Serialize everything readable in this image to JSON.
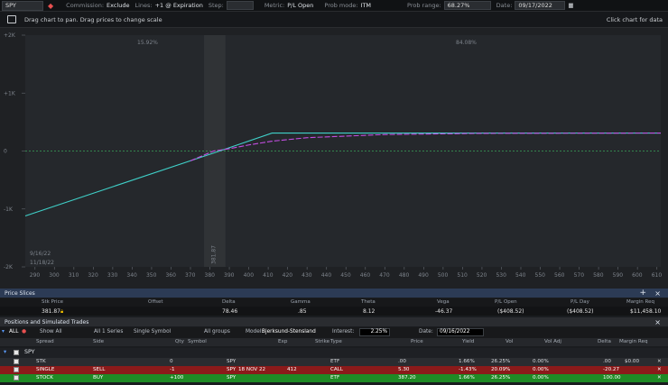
{
  "toolbar": {
    "symbol": "SPY",
    "commission_label": "Commission:",
    "commission_value": "Exclude",
    "lines_label": "Lines:",
    "lines_value": "+1 @ Expiration",
    "step_label": "Step:",
    "step_value": "",
    "metric_label": "Metric:",
    "metric_value": "P/L Open",
    "probmode_label": "Prob mode:",
    "probmode_value": "ITM",
    "probrange_label": "Prob range:",
    "probrange_value": "68.27%",
    "date_label": "Date:",
    "date_value": "09/17/2022"
  },
  "subbar": {
    "hint": "Drag chart to pan. Drag prices to change scale",
    "right": "Click chart for data"
  },
  "chart_data": {
    "type": "line",
    "y_ticks": [
      "+2K",
      "+1K",
      "0",
      "-1K",
      "-2K"
    ],
    "y_tick_values": [
      2000,
      1000,
      0,
      -1000,
      -2000
    ],
    "ylim": [
      -2000,
      2000
    ],
    "x_ticks": [
      "290",
      "300",
      "310",
      "320",
      "330",
      "340",
      "350",
      "360",
      "370",
      "380",
      "390",
      "400",
      "410",
      "420",
      "430",
      "440",
      "450",
      "460",
      "470",
      "480",
      "490",
      "500",
      "510",
      "520",
      "530",
      "540",
      "550",
      "560",
      "570",
      "580",
      "590",
      "600",
      "610"
    ],
    "xlim": [
      285,
      612
    ],
    "prob_left": "15.92%",
    "prob_right": "84.08%",
    "price_marker": "381.87",
    "date1": "9/16/22",
    "date2": "11/18/22",
    "series": [
      {
        "x": [
          285,
          385,
          412,
          612
        ],
        "y": [
          -1120,
          0,
          310,
          310
        ],
        "color": "#3fd0c8"
      },
      {
        "x": [
          370,
          381.87,
          390,
          400,
          412,
          430,
          470,
          520,
          612
        ],
        "y": [
          -170,
          0,
          40,
          105,
          170,
          230,
          285,
          305,
          310
        ],
        "color": "#c24ee0"
      }
    ]
  },
  "price_slices": {
    "title": "Price Slices",
    "headers": [
      "Stk Price",
      "Offset",
      "Delta",
      "Gamma",
      "Theta",
      "Vega",
      "P/L Open",
      "P/L Day",
      "Margin Req"
    ],
    "values": [
      "381.87",
      "",
      "78.46",
      ".85",
      "8.12",
      "-46.37",
      "($408.52)",
      "($408.52)",
      "$11,458.10"
    ]
  },
  "positions": {
    "title": "Positions and Simulated Trades",
    "filters": {
      "all": "ALL",
      "show": "Show All",
      "series": "All 1 Series",
      "single": "Single Symbol",
      "groups": "All groups",
      "model_label": "Model:",
      "model_value": "Bjerksund-Stensland",
      "interest_label": "Interest:",
      "interest_value": "2.25%",
      "date_label": "Date:",
      "date_value": "09/16/2022"
    },
    "headers": [
      "Spread",
      "Side",
      "Qty",
      "Symbol",
      "Exp",
      "Strike",
      "Type",
      "Price",
      "Yield",
      "Vol",
      "Vol Adj",
      "Delta",
      "Margin Req"
    ],
    "group": "SPY",
    "rows": [
      {
        "spread": "STK",
        "side": "",
        "qty": "0",
        "symbol": "SPY",
        "exp": "",
        "strike": "",
        "type": "ETF",
        "price": ".00",
        "yield": "1.66%",
        "vol": "26.25%",
        "voladj": "0.00%",
        "delta": ".00",
        "margin": "$0.00"
      },
      {
        "spread": "SINGLE",
        "side": "SELL",
        "qty": "-1",
        "symbol": "SPY",
        "exp": "18 NOV 22",
        "strike": "412",
        "type": "CALL",
        "price": "5.30",
        "yield": "-1.43%",
        "vol": "20.09%",
        "voladj": "0.00%",
        "delta": "-20.27",
        "margin": ""
      },
      {
        "spread": "STOCK",
        "side": "BUY",
        "qty": "+100",
        "symbol": "SPY",
        "exp": "",
        "strike": "",
        "type": "ETF",
        "price": "387.20",
        "yield": "1.66%",
        "vol": "26.25%",
        "voladj": "0.00%",
        "delta": "100.00",
        "margin": ""
      }
    ]
  }
}
